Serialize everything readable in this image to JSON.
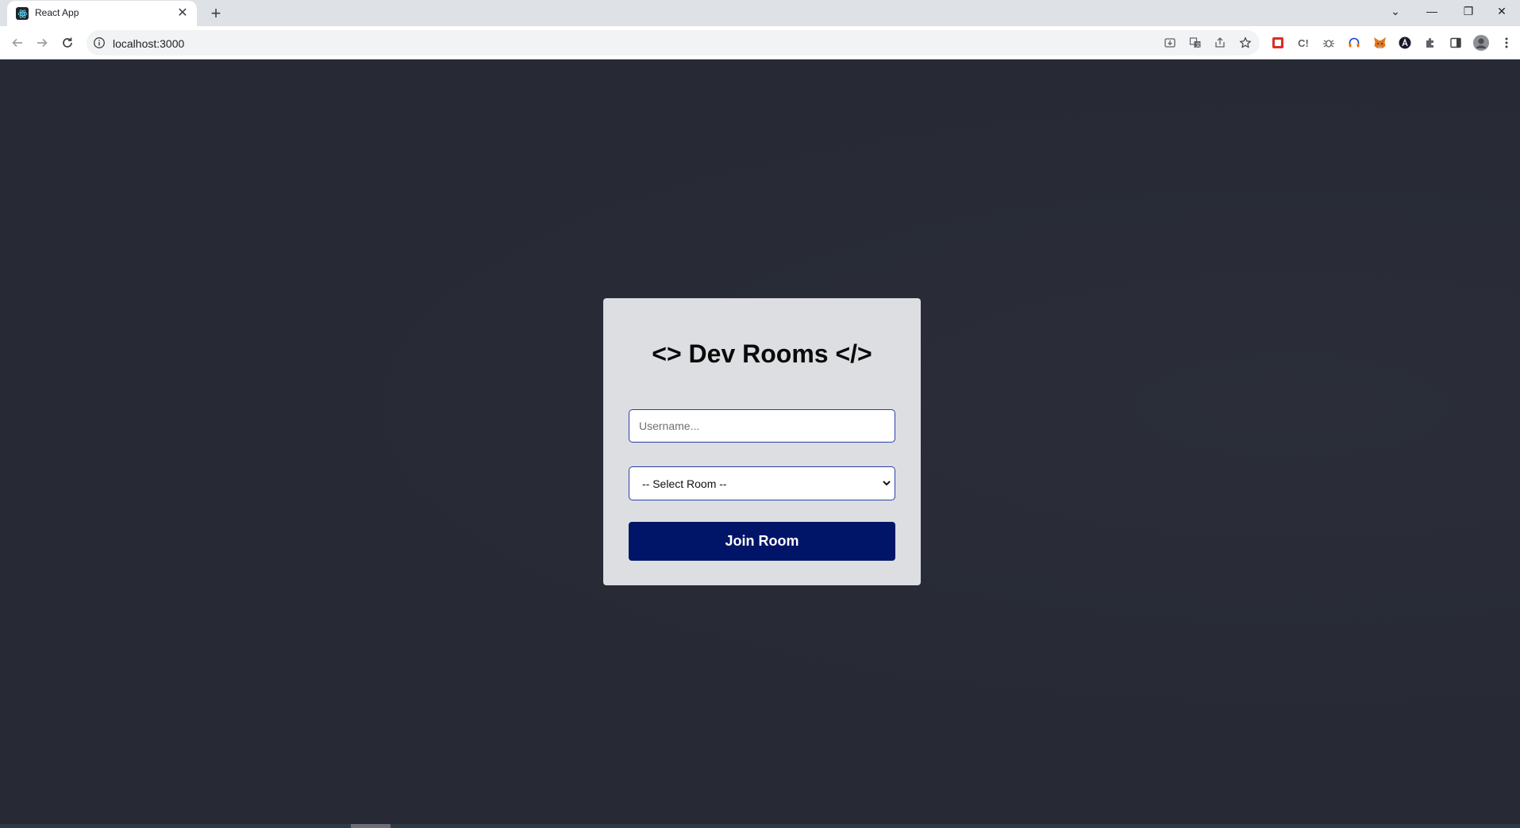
{
  "browser": {
    "tab": {
      "title": "React App",
      "favicon": "react-logo-icon",
      "close_glyph": "✕"
    },
    "new_tab_glyph": "+",
    "window_controls": {
      "tab_search": "⌄",
      "minimize": "—",
      "restore": "❐",
      "close": "✕"
    },
    "address_bar": {
      "url": "localhost:3000",
      "info_icon": "info-icon"
    },
    "omnibox_actions": [
      "install-icon",
      "translate-icon",
      "share-icon",
      "bookmark-star-icon"
    ],
    "extensions": [
      "ext-red-icon",
      "ext-c-icon",
      "ext-bug-icon",
      "ext-headset-icon",
      "metamask-fox-icon",
      "ext-a-icon",
      "puzzle-icon",
      "side-panel-icon",
      "profile-avatar-icon",
      "menu-kebab-icon"
    ]
  },
  "page": {
    "title": "<> Dev Rooms </>",
    "username": {
      "value": "",
      "placeholder": "Username..."
    },
    "room_select": {
      "selected": "-- Select Room --"
    },
    "join_button": "Join Room"
  },
  "colors": {
    "background": "#272a35",
    "card": "#dcdee1",
    "button": "#001567",
    "input_border": "#2b3fa8"
  }
}
